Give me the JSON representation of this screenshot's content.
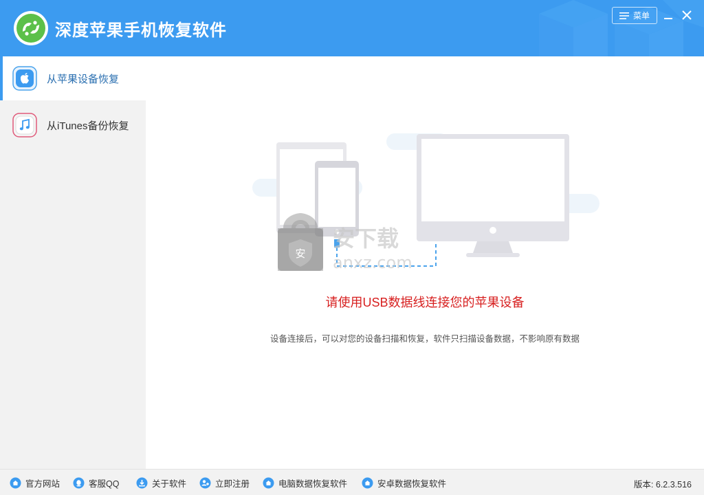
{
  "app": {
    "title": "深度苹果手机恢复软件",
    "menu_label": "菜单"
  },
  "sidebar": {
    "items": [
      {
        "label": "从苹果设备恢复",
        "icon": "apple-icon",
        "active": true
      },
      {
        "label": "从iTunes备份恢复",
        "icon": "music-note-icon",
        "active": false
      }
    ]
  },
  "main": {
    "headline": "请使用USB数据线连接您的苹果设备",
    "subtext": "设备连接后，可以对您的设备扫描和恢复，软件只扫描设备数据，不影响原有数据",
    "watermark": {
      "char": "安",
      "main": "安下载",
      "domain": "anxz.com"
    }
  },
  "footer": {
    "links": [
      {
        "label": "官方网站",
        "icon": "home-icon"
      },
      {
        "label": "客服QQ",
        "icon": "qq-icon"
      },
      {
        "label": "关于软件",
        "icon": "download-icon"
      },
      {
        "label": "立即注册",
        "icon": "add-user-icon"
      },
      {
        "label": "电脑数据恢复软件",
        "icon": "home-icon"
      },
      {
        "label": "安卓数据恢复软件",
        "icon": "home-icon"
      }
    ],
    "version": "版本: 6.2.3.516"
  },
  "colors": {
    "titlebar": "#3c9bf0",
    "sidebar_bg": "#f2f2f2",
    "headline": "#d71f1f",
    "accent": "#2a6fb0"
  }
}
